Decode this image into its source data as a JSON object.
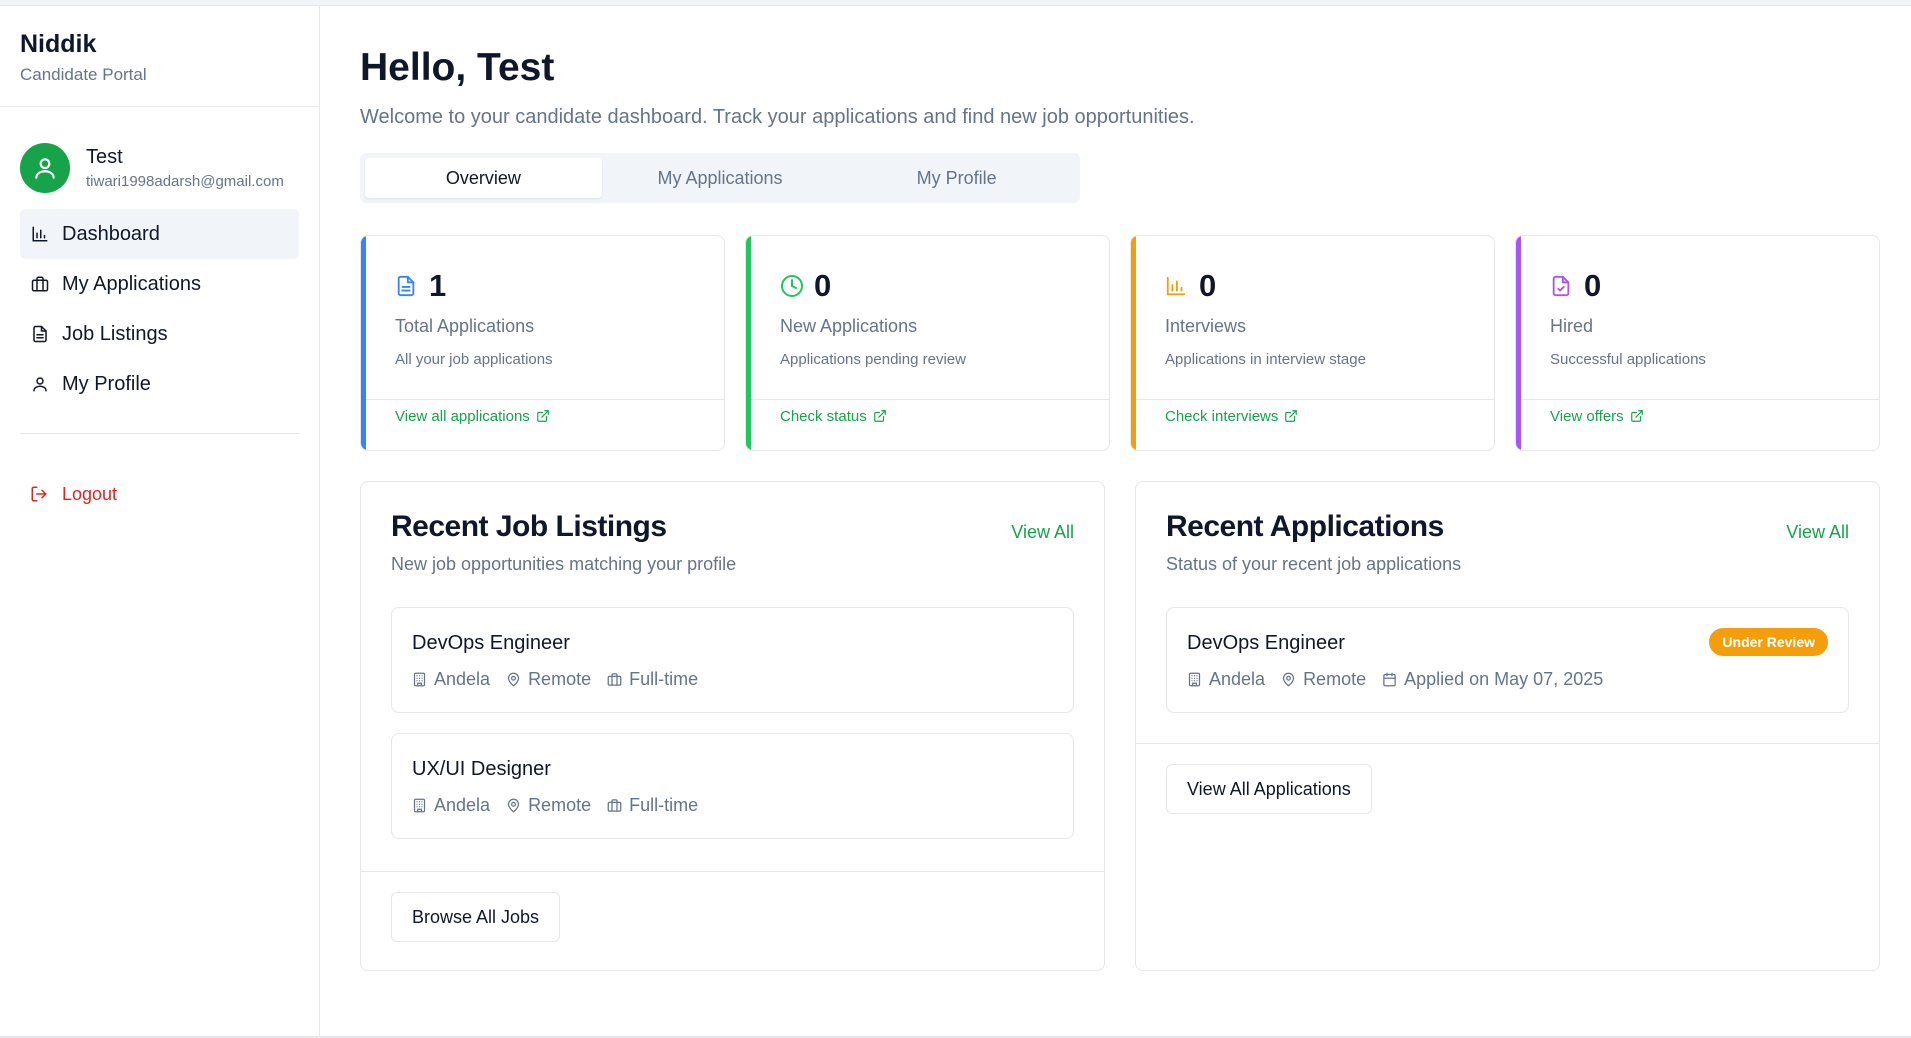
{
  "brand": {
    "name": "Niddik",
    "subtitle": "Candidate Portal"
  },
  "user": {
    "name": "Test",
    "email": "tiwari1998adarsh@gmail.com"
  },
  "nav": [
    {
      "label": "Dashboard",
      "icon": "bar-chart-icon",
      "active": true
    },
    {
      "label": "My Applications",
      "icon": "briefcase-icon",
      "active": false
    },
    {
      "label": "Job Listings",
      "icon": "document-icon",
      "active": false
    },
    {
      "label": "My Profile",
      "icon": "user-icon",
      "active": false
    }
  ],
  "logout": "Logout",
  "header": {
    "greeting": "Hello, Test",
    "welcome": "Welcome to your candidate dashboard. Track your applications and find new job opportunities."
  },
  "tabs": [
    {
      "label": "Overview",
      "active": true
    },
    {
      "label": "My Applications",
      "active": false
    },
    {
      "label": "My Profile",
      "active": false
    }
  ],
  "stats": [
    {
      "value": "1",
      "label": "Total Applications",
      "desc": "All your job applications",
      "link": "View all applications",
      "color": "#3b82f6",
      "icon": "document-icon"
    },
    {
      "value": "0",
      "label": "New Applications",
      "desc": "Applications pending review",
      "link": "Check status",
      "color": "#22c55e",
      "icon": "clock-icon"
    },
    {
      "value": "0",
      "label": "Interviews",
      "desc": "Applications in interview stage",
      "link": "Check interviews",
      "color": "#f59e0b",
      "icon": "bar-chart-icon"
    },
    {
      "value": "0",
      "label": "Hired",
      "desc": "Successful applications",
      "link": "View offers",
      "color": "#a855f7",
      "icon": "file-check-icon"
    }
  ],
  "recent_jobs": {
    "title": "Recent Job Listings",
    "subtitle": "New job opportunities matching your profile",
    "view_all": "View All",
    "items": [
      {
        "title": "DevOps Engineer",
        "company": "Andela",
        "location": "Remote",
        "type": "Full-time"
      },
      {
        "title": "UX/UI Designer",
        "company": "Andela",
        "location": "Remote",
        "type": "Full-time"
      }
    ],
    "button": "Browse All Jobs"
  },
  "recent_applications": {
    "title": "Recent Applications",
    "subtitle": "Status of your recent job applications",
    "view_all": "View All",
    "items": [
      {
        "title": "DevOps Engineer",
        "company": "Andela",
        "location": "Remote",
        "applied": "Applied on May 07, 2025",
        "status": "Under Review"
      }
    ],
    "button": "View All Applications"
  },
  "colors": {
    "accent": "#16a34a",
    "danger": "#dc2626",
    "badge": "#f59e0b"
  }
}
